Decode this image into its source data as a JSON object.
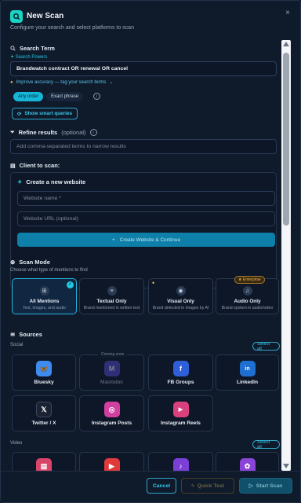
{
  "header": {
    "title": "New Scan",
    "subtitle": "Configure your search and select platforms to scan",
    "close": "×"
  },
  "search": {
    "label": "Search Term",
    "powers": "Search Powers",
    "value": "Brandwatch contract OR renewal OR cancel",
    "improve": "Improve accuracy — tag your search terms",
    "order_any": "Any order",
    "order_exact": "Exact phrase",
    "smart_button": "Show smart queries"
  },
  "refine": {
    "label": "Refine results",
    "optional": "(optional)",
    "placeholder": "Add comma-separated terms to narrow results"
  },
  "client": {
    "label": "Client to scan:",
    "create_title": "Create a new website",
    "name_placeholder": "Website name *",
    "url_placeholder": "Website URL (optional)",
    "create_button": "Create Website & Continue"
  },
  "scan_mode": {
    "label": "Scan Mode",
    "desc": "Choose what type of mentions to find",
    "modes": [
      {
        "title": "All Mentions",
        "desc": "Text, images, and audio",
        "icon": "grid-icon"
      },
      {
        "title": "Textual Only",
        "desc": "Brand mentioned in written text",
        "icon": "text-icon"
      },
      {
        "title": "Visual Only",
        "desc": "Brand detected in images by AI",
        "icon": "eye-icon"
      },
      {
        "title": "Audio Only",
        "desc": "Brand spoken in audio/video",
        "icon": "headphones-icon",
        "badge": "Enterprise"
      }
    ]
  },
  "sources": {
    "label": "Sources",
    "social_label": "Social",
    "select_all": "Select all",
    "coming_soon": "Coming soon",
    "social": [
      {
        "name": "Bluesky",
        "color": "#3f8cf0",
        "glyph": "🦋"
      },
      {
        "name": "Mastodon",
        "color": "#5b4bd6",
        "glyph": "M",
        "disabled": true
      },
      {
        "name": "FB Groups",
        "color": "#2f5fd8",
        "glyph": "f"
      },
      {
        "name": "LinkedIn",
        "color": "#1f6fd1",
        "glyph": "in"
      },
      {
        "name": "Twitter / X",
        "color": "#1b2333",
        "glyph": "𝕏"
      },
      {
        "name": "Instagram Posts",
        "color": "#d13fa0",
        "glyph": "◎"
      },
      {
        "name": "Instagram Reels",
        "color": "#d9417e",
        "glyph": "▶"
      }
    ],
    "video_label": "Video",
    "video": [
      {
        "color": "#d8446a"
      },
      {
        "color": "#e03a3a"
      },
      {
        "color": "#7b3fd6"
      },
      {
        "color": "#8a45d8"
      }
    ]
  },
  "footer": {
    "cancel": "Cancel",
    "quick_test": "Quick Test",
    "start": "Start Scan"
  },
  "colors": {
    "accent": "#22c7e0",
    "background": "#0f1a2b"
  }
}
